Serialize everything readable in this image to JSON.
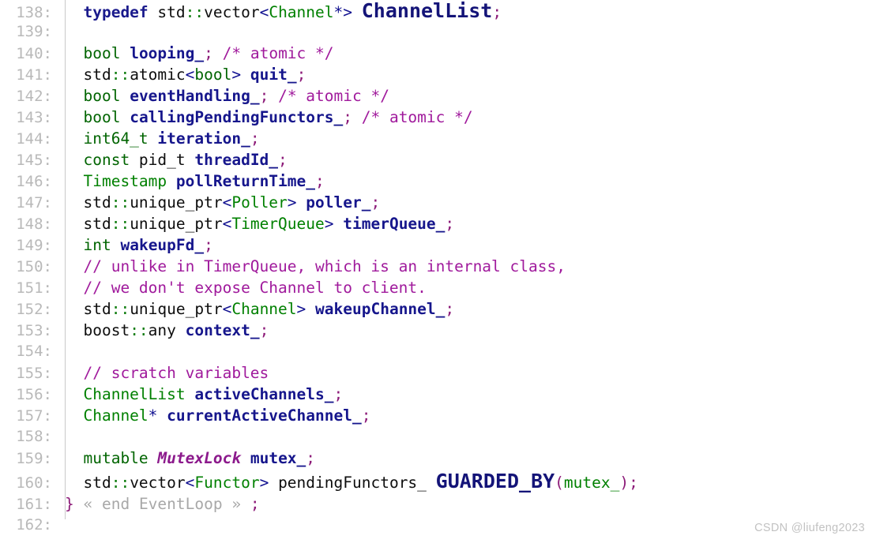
{
  "editor": {
    "language": "C++",
    "watermark": "CSDN @liufeng2023",
    "colors": {
      "background": "#ffffff",
      "line_number": "#b9b9b9",
      "keyword": "#006400",
      "type_name": "#008000",
      "identifier": "#16168c",
      "comment": "#a01a9c",
      "punctuation": "#8c1a78",
      "scope_operator": "#0a7a0a",
      "emphasis": "#141478",
      "gutter_rule": "#c9c9c9"
    },
    "lines": [
      {
        "no": "138:",
        "text": "typedef std::vector<Channel*> ChannelList;"
      },
      {
        "no": "139:",
        "text": ""
      },
      {
        "no": "140:",
        "text": "bool looping_; /* atomic */"
      },
      {
        "no": "141:",
        "text": "std::atomic<bool> quit_;"
      },
      {
        "no": "142:",
        "text": "bool eventHandling_; /* atomic */"
      },
      {
        "no": "143:",
        "text": "bool callingPendingFunctors_; /* atomic */"
      },
      {
        "no": "144:",
        "text": "int64_t iteration_;"
      },
      {
        "no": "145:",
        "text": "const pid_t threadId_;"
      },
      {
        "no": "146:",
        "text": "Timestamp pollReturnTime_;"
      },
      {
        "no": "147:",
        "text": "std::unique_ptr<Poller> poller_;"
      },
      {
        "no": "148:",
        "text": "std::unique_ptr<TimerQueue> timerQueue_;"
      },
      {
        "no": "149:",
        "text": "int wakeupFd_;"
      },
      {
        "no": "150:",
        "text": "// unlike in TimerQueue, which is an internal class,"
      },
      {
        "no": "151:",
        "text": "// we don't expose Channel to client."
      },
      {
        "no": "152:",
        "text": "std::unique_ptr<Channel> wakeupChannel_;"
      },
      {
        "no": "153:",
        "text": "boost::any context_;"
      },
      {
        "no": "154:",
        "text": ""
      },
      {
        "no": "155:",
        "text": "// scratch variables"
      },
      {
        "no": "156:",
        "text": "ChannelList activeChannels_;"
      },
      {
        "no": "157:",
        "text": "Channel* currentActiveChannel_;"
      },
      {
        "no": "158:",
        "text": ""
      },
      {
        "no": "159:",
        "text": "mutable MutexLock mutex_;"
      },
      {
        "no": "160:",
        "text": "std::vector<Functor> pendingFunctors_ GUARDED_BY(mutex_);"
      },
      {
        "no": "161:",
        "text": "} « end EventLoop » ;"
      },
      {
        "no": "162:",
        "text": ""
      }
    ],
    "fold_marker": "« end EventLoop »"
  }
}
